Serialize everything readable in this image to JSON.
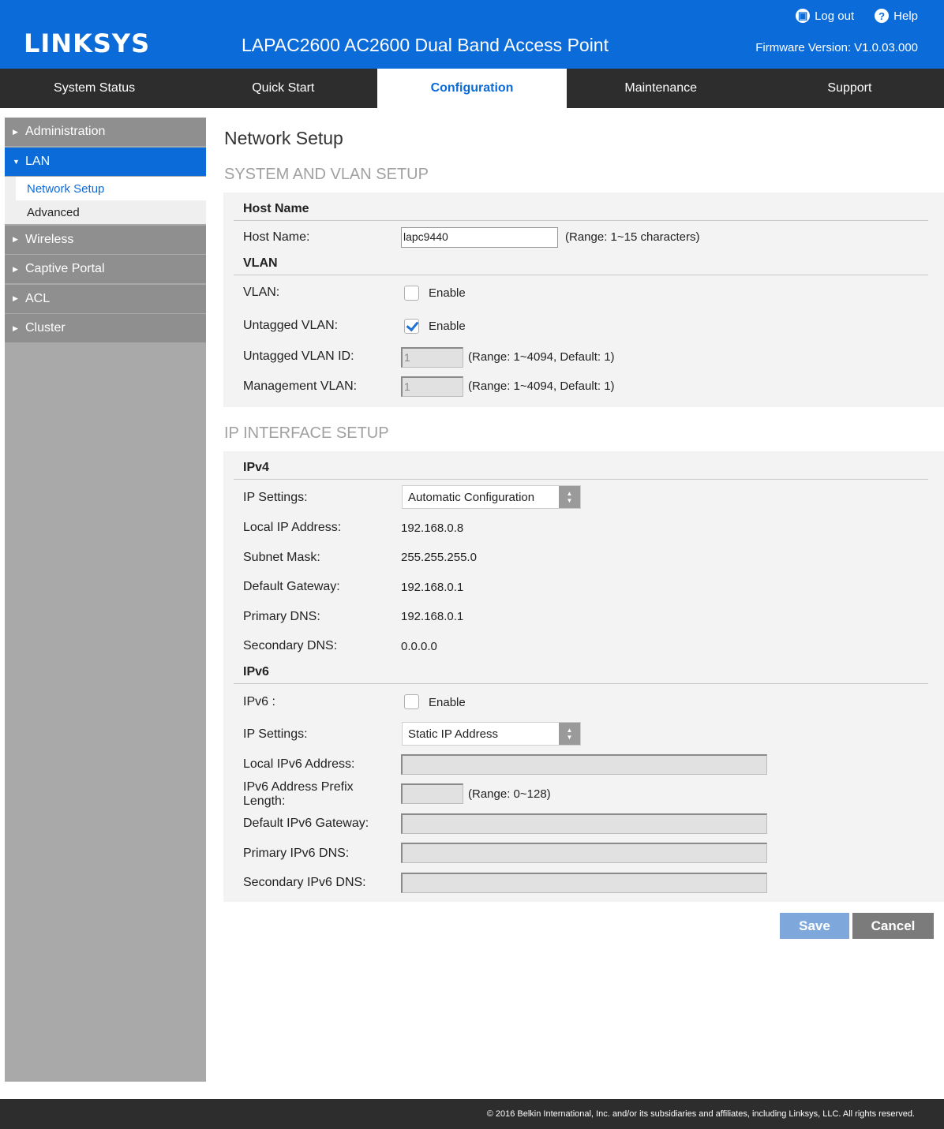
{
  "header": {
    "logo": "LINKSYS",
    "product": "LAPAC2600 AC2600 Dual Band Access Point",
    "firmware_label": "Firmware Version:",
    "firmware_value": "V1.0.03.000",
    "logout": "Log out",
    "help": "Help"
  },
  "nav": {
    "tabs": [
      "System Status",
      "Quick Start",
      "Configuration",
      "Maintenance",
      "Support"
    ],
    "active": "Configuration"
  },
  "sidebar": {
    "items": [
      {
        "label": "Administration"
      },
      {
        "label": "LAN",
        "subitems": [
          "Network Setup",
          "Advanced"
        ]
      },
      {
        "label": "Wireless"
      },
      {
        "label": "Captive Portal"
      },
      {
        "label": "ACL"
      },
      {
        "label": "Cluster"
      }
    ]
  },
  "main": {
    "title": "Network Setup",
    "section1": "SYSTEM AND VLAN SETUP",
    "host": {
      "group": "Host Name",
      "label": "Host Name:",
      "value": "lapc9440",
      "note": "(Range: 1~15 characters)"
    },
    "vlan": {
      "group": "VLAN",
      "vlan_label": "VLAN:",
      "vlan_enable": "Enable",
      "untagged_label": "Untagged VLAN:",
      "untagged_enable": "Enable",
      "untagged_id_label": "Untagged VLAN ID:",
      "untagged_id_value": "1",
      "untagged_id_note": "(Range: 1~4094, Default: 1)",
      "mgmt_label": "Management VLAN:",
      "mgmt_value": "1",
      "mgmt_note": "(Range: 1~4094, Default: 1)"
    },
    "section2": "IP INTERFACE SETUP",
    "ipv4": {
      "group": "IPv4",
      "settings_label": "IP Settings:",
      "settings_value": "Automatic Configuration",
      "local_ip_label": "Local IP Address:",
      "local_ip": "192.168.0.8",
      "subnet_label": "Subnet Mask:",
      "subnet": "255.255.255.0",
      "gateway_label": "Default Gateway:",
      "gateway": "192.168.0.1",
      "dns1_label": "Primary DNS:",
      "dns1": "192.168.0.1",
      "dns2_label": "Secondary DNS:",
      "dns2": "0.0.0.0"
    },
    "ipv6": {
      "group": "IPv6",
      "ipv6_label": "IPv6 :",
      "ipv6_enable": "Enable",
      "settings_label": "IP Settings:",
      "settings_value": "Static IP Address",
      "local_label": "Local IPv6 Address:",
      "prefix_label_1": "IPv6 Address Prefix",
      "prefix_label_2": "Length:",
      "prefix_note": "(Range: 0~128)",
      "gateway_label": "Default IPv6 Gateway:",
      "dns1_label": "Primary IPv6 DNS:",
      "dns2_label": "Secondary IPv6 DNS:"
    },
    "save": "Save",
    "cancel": "Cancel"
  },
  "footer": {
    "text": "© 2016 Belkin International, Inc. and/or its subsidiaries and affiliates, including Linksys, LLC. All rights reserved."
  },
  "checkboxes": {
    "vlan": false,
    "untagged_vlan": true,
    "ipv6": false
  },
  "colors": {
    "brand": "#0a6bd9",
    "nav": "#2d2d2d",
    "sidebar": "#a9a9a9"
  }
}
